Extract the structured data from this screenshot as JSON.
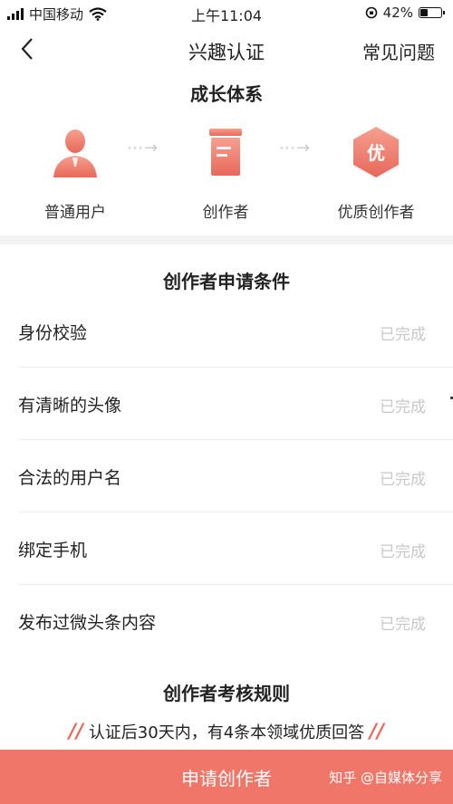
{
  "status_bar": {
    "carrier": "中国移动",
    "time": "上午11:04",
    "battery_percent": "42%",
    "battery_level": 0.42,
    "icons": [
      "signal-icon",
      "wifi-icon",
      "rotation-lock-icon",
      "battery-icon"
    ]
  },
  "nav": {
    "title": "兴趣认证",
    "faq_label": "常见问题",
    "back_icon": "chevron-left-icon"
  },
  "growth": {
    "title": "成长体系",
    "steps": [
      {
        "label": "普通用户",
        "icon": "user-icon"
      },
      {
        "label": "创作者",
        "icon": "document-icon"
      },
      {
        "label": "优质创作者",
        "icon": "quality-hexagon-icon",
        "badge": "优"
      }
    ],
    "arrow": "⋯→"
  },
  "conditions": {
    "title": "创作者申请条件",
    "items": [
      {
        "label": "身份校验",
        "status": "已完成"
      },
      {
        "label": "有清晰的头像",
        "status": "已完成"
      },
      {
        "label": "合法的用户名",
        "status": "已完成"
      },
      {
        "label": "绑定手机",
        "status": "已完成"
      },
      {
        "label": "发布过微头条内容",
        "status": "已完成"
      }
    ]
  },
  "rules": {
    "title": "创作者考核规则",
    "text": "认证后30天内，有4条本领域优质回答",
    "quote_mark": "//"
  },
  "footer": {
    "apply_label": "申请创作者",
    "watermark": "知乎 @自媒体分享"
  },
  "colors": {
    "accent": "#f0766a",
    "icon_gradient_top": "#f6a090",
    "icon_gradient_bottom": "#e8685a",
    "status_done": "#c8c8c8"
  }
}
